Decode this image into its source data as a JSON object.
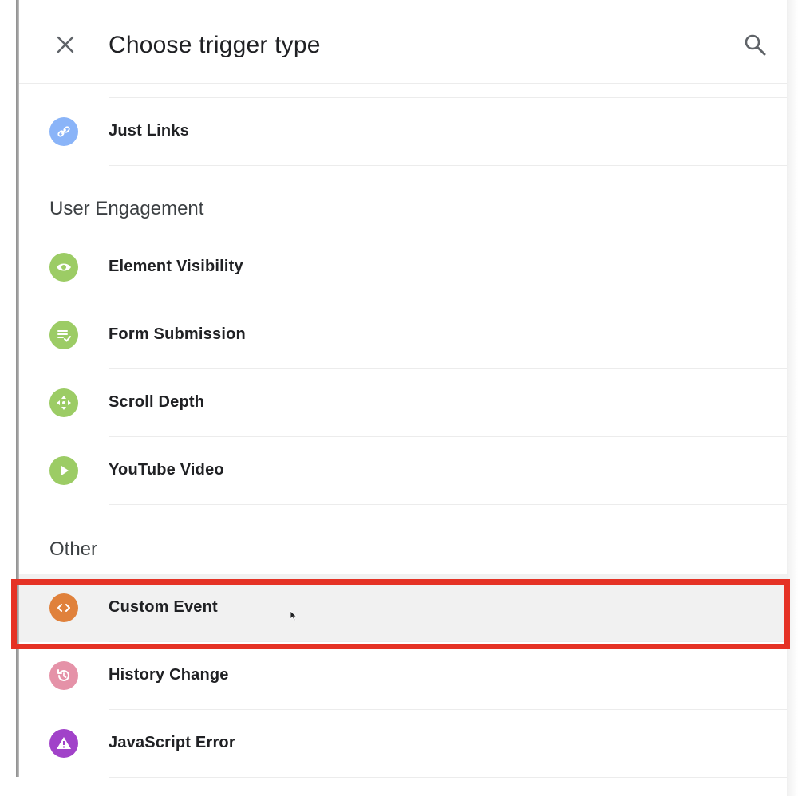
{
  "header": {
    "title": "Choose trigger type",
    "close_icon": "close-icon",
    "search_icon": "search-icon"
  },
  "sections": [
    {
      "heading": "",
      "items": [
        {
          "label": "Just Links",
          "icon": "link-icon",
          "color": "#8ab4f8"
        }
      ]
    },
    {
      "heading": "User Engagement",
      "items": [
        {
          "label": "Element Visibility",
          "icon": "eye-icon",
          "color": "#9ccc65"
        },
        {
          "label": "Form Submission",
          "icon": "form-check-icon",
          "color": "#9ccc65"
        },
        {
          "label": "Scroll Depth",
          "icon": "scroll-arrows-icon",
          "color": "#9ccc65"
        },
        {
          "label": "YouTube Video",
          "icon": "play-icon",
          "color": "#9ccc65"
        }
      ]
    },
    {
      "heading": "Other",
      "items": [
        {
          "label": "Custom Event",
          "icon": "code-icon",
          "color": "#e0813b",
          "selected": true
        },
        {
          "label": "History Change",
          "icon": "history-icon",
          "color": "#e592a8"
        },
        {
          "label": "JavaScript Error",
          "icon": "warning-icon",
          "color": "#a142c9"
        }
      ]
    }
  ],
  "highlight_color": "#e53225"
}
